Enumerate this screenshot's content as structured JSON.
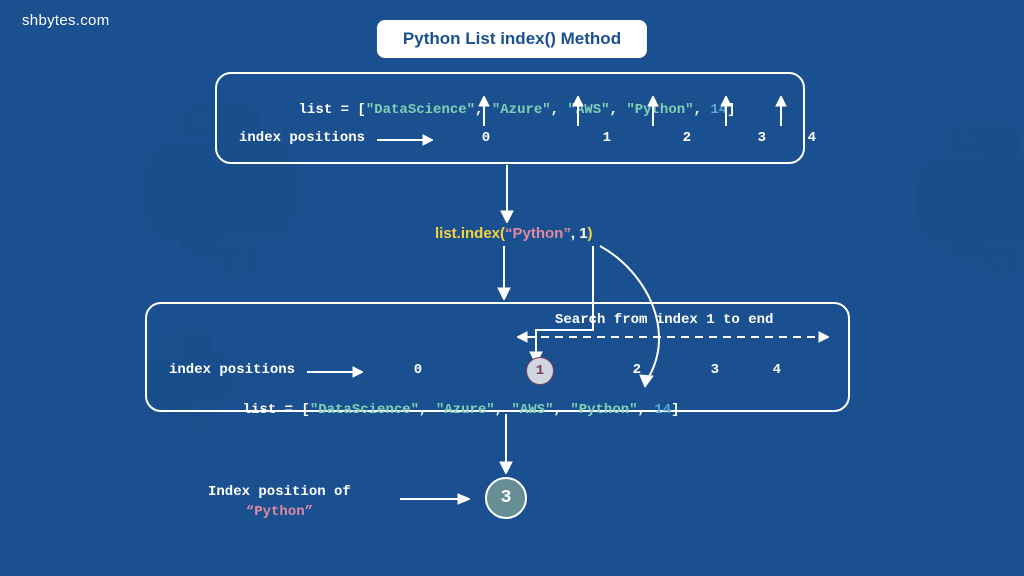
{
  "site": "shbytes.com",
  "title": "Python List index() Method",
  "list_decl": {
    "prefix": "list = [",
    "items": [
      "\"DataScience\"",
      "\"Azure\"",
      "\"AWS\"",
      "\"Python\"",
      "14"
    ],
    "suffix": "]"
  },
  "index_label": "index positions",
  "indices": [
    "0",
    "1",
    "2",
    "3",
    "4"
  ],
  "method": {
    "obj": "list.index(",
    "arg1": "“Python”",
    "sep": ", ",
    "arg2": "1",
    "close": ")"
  },
  "search_label": "Search from index 1 to end",
  "highlight_index": "1",
  "result_label_l1": "Index position of",
  "result_label_l2": "“Python”",
  "result_value": "3",
  "chart_data": {
    "type": "table",
    "title": "Python List index() Method",
    "list_items": [
      "DataScience",
      "Azure",
      "AWS",
      "Python",
      14
    ],
    "indices": [
      0,
      1,
      2,
      3,
      4
    ],
    "call": "list.index(\"Python\", 1)",
    "search_start": 1,
    "search_end": 4,
    "search_target": "Python",
    "result": 3
  }
}
